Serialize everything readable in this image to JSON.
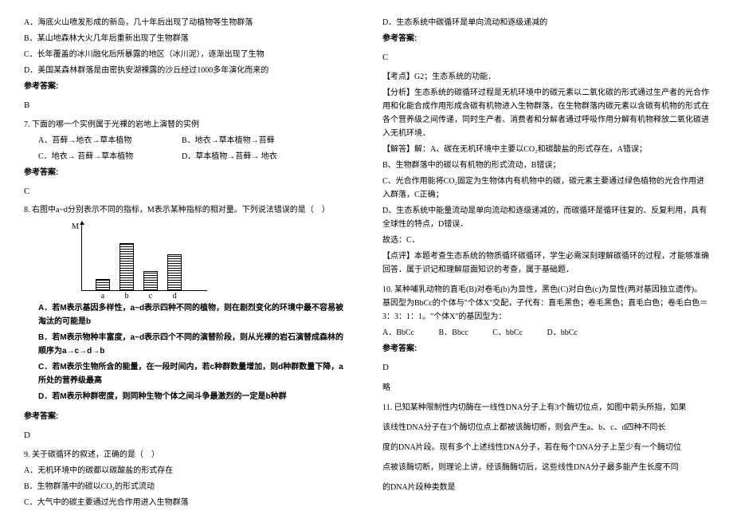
{
  "left": {
    "l1": "A．海底火山喷发形成的新岛，几十年后出现了动植物等生物群落",
    "l2": "B．某山地森林大火几年后重新出现了生物群落",
    "l3": "C．长年覆盖的冰川融化后所暴露的地区（冰川泥），逐渐出现了生物",
    "l4": "D．美国某森林群落是由密执安湖裸露的沙丘经过1000多年演化而来的",
    "ans_label": "参考答案:",
    "ans1": "B",
    "q7": "7. 下面的哪一个实例属于光裸的岩地上演替的实例",
    "q7a": "A．苔藓→地衣→草本植物",
    "q7b": "B．地衣→草本植物→苔藓",
    "q7c": "C．地衣→ 苔藓→草本植物",
    "q7d": "D．草本植物→苔藓→ 地衣",
    "ans2": "C",
    "q8": "8. 右图中a~d分别表示不同的指标，M表示某种指标的相对量。下列说法错误的是（　）",
    "chart_ylabel": "M",
    "chart_xA": "a",
    "chart_xB": "b",
    "chart_xC": "c",
    "chart_xD": "d",
    "q8a": "A．若M表示基因多样性，a~d表示四种不同的植物，则在剧烈变化的环境中最不容易被淘汰的可能是b",
    "q8b": "B．若M表示物种丰富度，a~d表示四个不同的演替阶段，则从光裸的岩石演替成森林的顺序为a→c→d→b",
    "q8c": "C．若M表示生物所含的能量，在一段时间内，若c种群数量增加，则d种群数量下降，a所处的营养级最高",
    "q8d": "D．若M表示种群密度，则同种生物个体之间斗争最激烈的一定是b种群",
    "ans3": "D",
    "q9": "9. 关于碳循环的叙述，正确的是（　）",
    "q9a": "A．无机环境中的碳都以碳酸盐的形式存在",
    "q9b": "B．生物群落中的碳以CO₂的形式流动",
    "q9c": "C．大气中的碳主要通过光合作用进入生物群落"
  },
  "right": {
    "q9d": "D．生态系统中碳循环是单向流动和逐级递减的",
    "ans_label": "参考答案:",
    "ans9": "C",
    "kd": "【考点】G2；生态系统的功能．",
    "fx1": "【分析】生态系统的碳循环过程是无机环境中的碳元素以二氧化碳的形式通过生产者的光合作用和化能合成作用形成含碳有机物进入生物群落，在生物群落内碳元素以含碳有机物的形式在各个营养级之间传递，同时生产者、消费者和分解者通过呼吸作用分解有机物释放二氧化碳进入无机环境．",
    "jd_a": "【解答】解：A、碳在无机环境中主要以CO₂和碳酸盐的形式存在，A错误；",
    "jd_b": "B、生物群落中的碳以有机物的形式流动，B错误；",
    "jd_c": "C、光合作用能将CO₂固定为生物体内有机物中的碳，碳元素主要通过绿色植物的光合作用进入群落，C正确；",
    "jd_d": "D、生态系统中能量流动是单向流动和逐级递减的，而碳循环是循环往复的、反复利用，具有全球性的特点，D错误．",
    "gx": "故选：C．",
    "dp": "【点评】本题考查生态系统的物质循环碳循环，学生必需深刻理解碳循环的过程，才能够准确回答．属于识记和理解层面知识的考查，属于基础题．",
    "q10_1": "10. 某种哺乳动物的直毛(B)对卷毛(b)为显性，黑色(C)对白色(c)为显性(两对基因独立遗传)。基因型为BbCc的个体与\"个体X\"交配，子代有：直毛黑色；卷毛黑色；直毛白色；卷毛白色＝3：3：1：1。\"个体X\"的基因型为：",
    "q10a": "A．BbCc",
    "q10b": "B．Bbcc",
    "q10c": "C．bbCc",
    "q10d": "D．bbCc",
    "ans10": "D",
    "lue": "略",
    "q11_1": "11. 已知某种限制性内切酶在一线性DNA分子上有3个酶切位点，如图中箭头所指，如果",
    "q11_2": "该线性DNA分子在3个酶切位点上都被该酶切断，则会产生a、b、c、d四种不同长",
    "q11_3": "度的DNA片段。现有多个上述线性DNA分子，若在每个DNA分子上至少有一个酶切位",
    "q11_4": "点被该酶切断，则理论上讲，经该酶酶切后，这些线性DNA分子最多能产生长度不同",
    "q11_5": "的DNA片段种类数是"
  },
  "chart_data": {
    "type": "bar",
    "categories": [
      "a",
      "b",
      "c",
      "d"
    ],
    "values": [
      15,
      60,
      25,
      46
    ],
    "title": "",
    "xlabel": "",
    "ylabel": "M",
    "ylim": [
      0,
      70
    ]
  }
}
